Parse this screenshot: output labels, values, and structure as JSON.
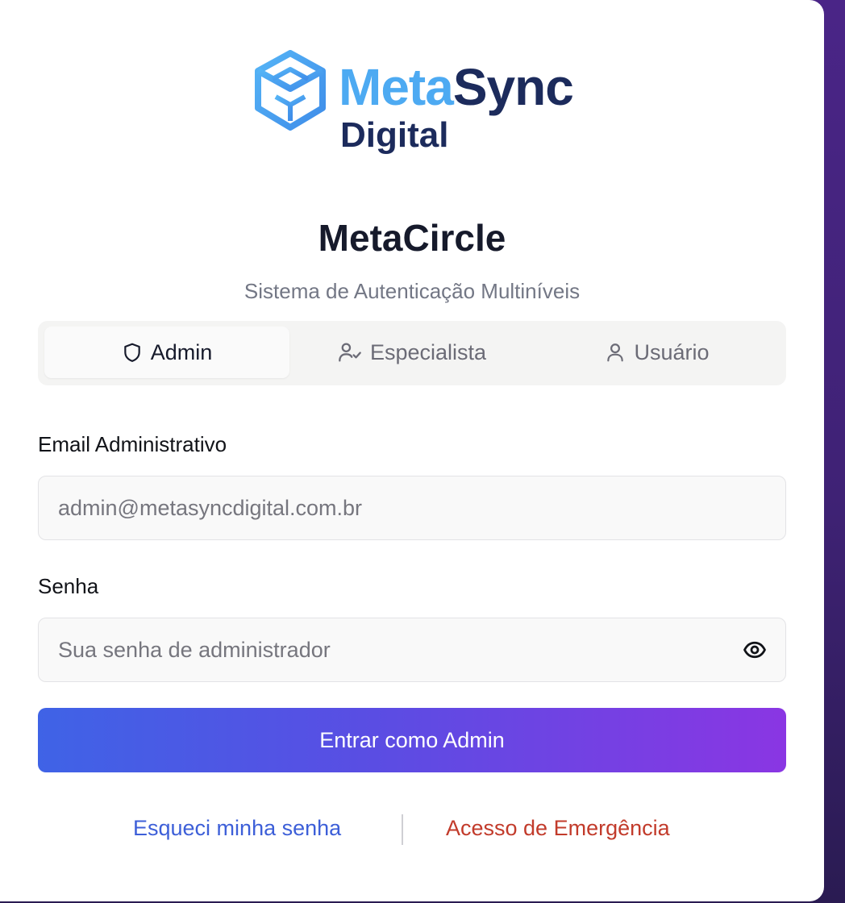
{
  "brand": {
    "name_part1": "Meta",
    "name_part2": "Sync",
    "subtitle": "Digital",
    "colors": {
      "light_blue": "#4daaf2",
      "navy": "#1c2b5c"
    }
  },
  "header": {
    "title": "MetaCircle",
    "subtitle": "Sistema de Autenticação Multiníveis"
  },
  "tabs": [
    {
      "label": "Admin",
      "icon": "shield-icon",
      "active": true
    },
    {
      "label": "Especialista",
      "icon": "user-check-icon",
      "active": false
    },
    {
      "label": "Usuário",
      "icon": "user-icon",
      "active": false
    }
  ],
  "form": {
    "email": {
      "label": "Email Administrativo",
      "placeholder": "admin@metasyncdigital.com.br",
      "value": ""
    },
    "password": {
      "label": "Senha",
      "placeholder": "Sua senha de administrador",
      "value": "",
      "toggle_icon": "eye-icon"
    },
    "submit_label": "Entrar como Admin"
  },
  "links": {
    "forgot_password": "Esqueci minha senha",
    "emergency_access": "Acesso de Emergência"
  },
  "colors": {
    "button_gradient_start": "#3f63e6",
    "button_gradient_end": "#8a36e3",
    "link_blue": "#3d5fd8",
    "link_red": "#c23b2b",
    "backdrop": "#4a2587"
  }
}
